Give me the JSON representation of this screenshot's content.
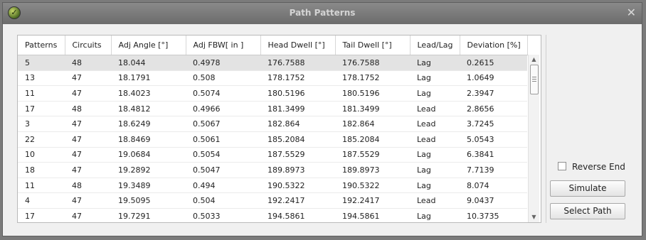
{
  "window": {
    "title": "Path Patterns",
    "close_glyph": "✕",
    "app_icon": "app-logo-icon"
  },
  "table": {
    "columns": [
      "Patterns",
      "Circuits",
      "Adj Angle [°]",
      "Adj FBW[ in ]",
      "Head Dwell [°]",
      "Tail Dwell [°]",
      "Lead/Lag",
      "Deviation [%]"
    ],
    "rows": [
      [
        "5",
        "48",
        "18.044",
        "0.4978",
        "176.7588",
        "176.7588",
        "Lag",
        "0.2615"
      ],
      [
        "13",
        "47",
        "18.1791",
        "0.508",
        "178.1752",
        "178.1752",
        "Lag",
        "1.0649"
      ],
      [
        "11",
        "47",
        "18.4023",
        "0.5074",
        "180.5196",
        "180.5196",
        "Lag",
        "2.3947"
      ],
      [
        "17",
        "48",
        "18.4812",
        "0.4966",
        "181.3499",
        "181.3499",
        "Lead",
        "2.8656"
      ],
      [
        "3",
        "47",
        "18.6249",
        "0.5067",
        "182.864",
        "182.864",
        "Lead",
        "3.7245"
      ],
      [
        "22",
        "47",
        "18.8469",
        "0.5061",
        "185.2084",
        "185.2084",
        "Lead",
        "5.0543"
      ],
      [
        "10",
        "47",
        "19.0684",
        "0.5054",
        "187.5529",
        "187.5529",
        "Lag",
        "6.3841"
      ],
      [
        "18",
        "47",
        "19.2892",
        "0.5047",
        "189.8973",
        "189.8973",
        "Lag",
        "7.7139"
      ],
      [
        "11",
        "48",
        "19.3489",
        "0.494",
        "190.5322",
        "190.5322",
        "Lag",
        "8.074"
      ],
      [
        "4",
        "47",
        "19.5095",
        "0.504",
        "192.2417",
        "192.2417",
        "Lead",
        "9.0437"
      ],
      [
        "17",
        "47",
        "19.7291",
        "0.5033",
        "194.5861",
        "194.5861",
        "Lag",
        "10.3735"
      ]
    ],
    "selected_row": 0
  },
  "controls": {
    "reverse_end_label": "Reverse End",
    "reverse_end_checked": false,
    "simulate_label": "Simulate",
    "select_path_label": "Select Path"
  },
  "colors": {
    "titlebar": "#7a7a7a",
    "selection": "#e3e3e3"
  }
}
